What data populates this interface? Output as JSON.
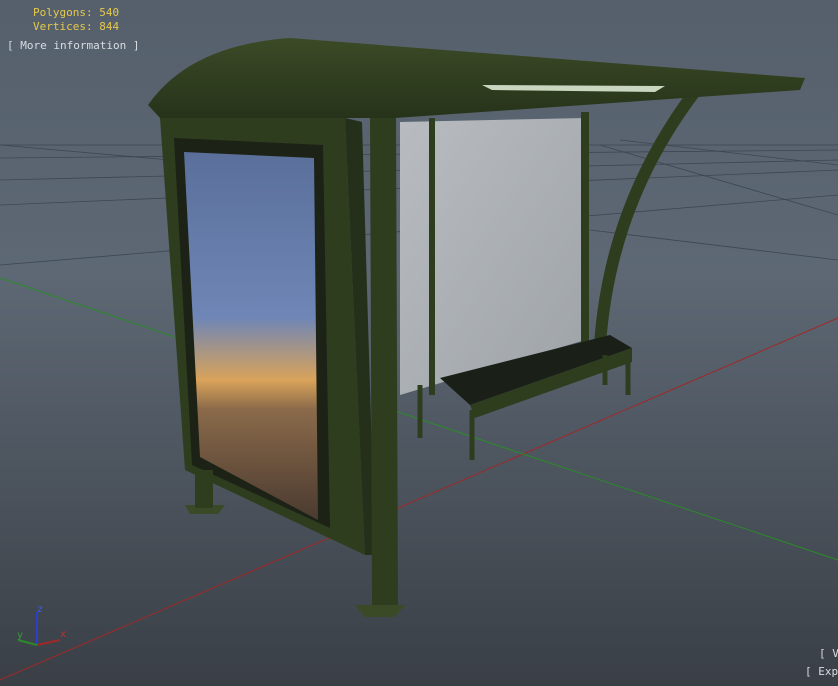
{
  "viewer": {
    "polygons_label": "Polygons: 540",
    "vertices_label": "Vertices: 844",
    "more_info_label": "[ More information ]",
    "view_link_label": "[ V",
    "export_link_label": "[ Exp"
  },
  "axis_gizmo": {
    "z": "z",
    "y": "y",
    "x": "x"
  },
  "colors": {
    "stats_text": "#e6c94a",
    "shelter_green": "#2f3d1f",
    "x_axis": "#a02828",
    "y_axis": "#2a8a2a",
    "z_axis": "#2a3fd0"
  },
  "model": {
    "name": "bus-shelter",
    "icon": "bus-shelter-3d-model"
  }
}
